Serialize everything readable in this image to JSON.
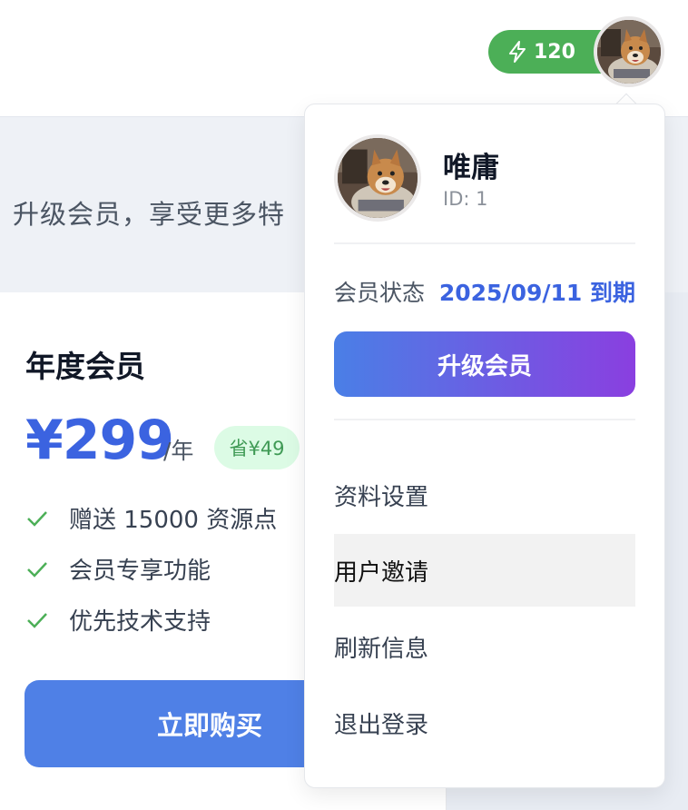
{
  "header": {
    "credits_value": "120",
    "credits_icon": "lightning-icon",
    "accent_green": "#4caf57"
  },
  "banner": {
    "text": "升级会员，享受更多特"
  },
  "plan": {
    "title": "年度会员",
    "price": "¥299",
    "period": "/年",
    "save_badge": "省¥49",
    "features": [
      "赠送 15000 资源点",
      "会员专享功能",
      "优先技术支持"
    ],
    "feature_icon": "check-icon",
    "buy_label": "立即购买",
    "accent_blue": "#3b63e0"
  },
  "user_menu": {
    "name": "唯庸",
    "id_text": "ID: 1",
    "status_label": "会员状态",
    "status_value": "2025/09/11 到期",
    "upgrade_label": "升级会员",
    "items": [
      {
        "label": "资料设置"
      },
      {
        "label": "用户邀请",
        "highlighted": true
      },
      {
        "label": "刷新信息"
      },
      {
        "label": "退出登录"
      }
    ]
  }
}
